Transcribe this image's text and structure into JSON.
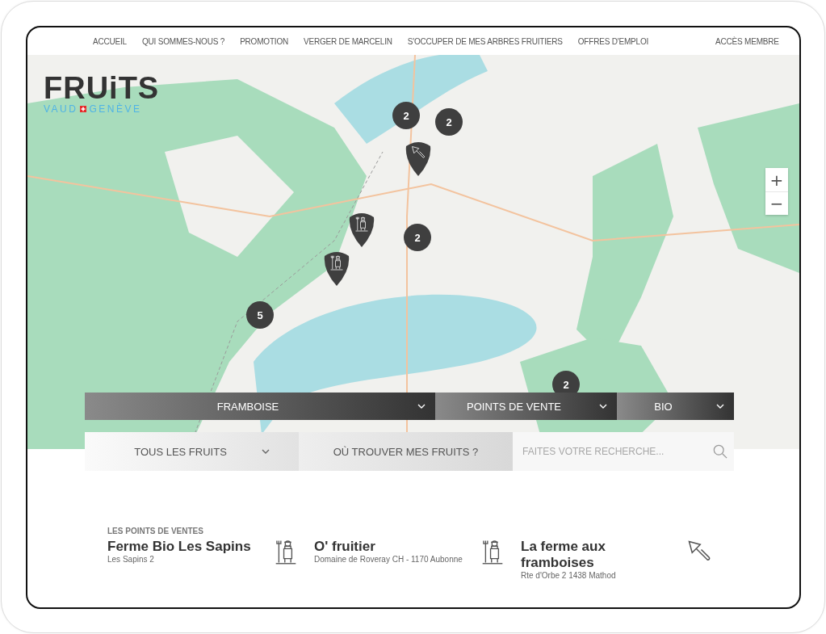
{
  "nav": {
    "items": [
      {
        "label": "ACCUEIL"
      },
      {
        "label": "QUI SOMMES-NOUS ?"
      },
      {
        "label": "PROMOTION"
      },
      {
        "label": "VERGER DE MARCELIN"
      },
      {
        "label": "S'OCCUPER DE MES ARBRES FRUITIERS"
      },
      {
        "label": "OFFRES D'EMPLOI"
      }
    ],
    "member_link": "ACCÈS MEMBRE"
  },
  "logo": {
    "title": "FRUiTS",
    "left": "VAUD",
    "right": "GENÈVE"
  },
  "map": {
    "markers": [
      {
        "kind": "cluster",
        "count": "2"
      },
      {
        "kind": "cluster",
        "count": "2"
      },
      {
        "kind": "trowel-pin"
      },
      {
        "kind": "farmer-pin"
      },
      {
        "kind": "cluster",
        "count": "2"
      },
      {
        "kind": "farmer-pin"
      },
      {
        "kind": "cluster",
        "count": "5"
      },
      {
        "kind": "cluster",
        "count": "2"
      }
    ],
    "zoom_in": "+",
    "zoom_out": "−"
  },
  "filters": [
    {
      "label": "FRAMBOISE"
    },
    {
      "label": "POINTS DE VENTE"
    },
    {
      "label": "BIO"
    }
  ],
  "search_bar": [
    {
      "kind": "dropdown",
      "label": "TOUS LES FRUITS"
    },
    {
      "kind": "button",
      "label": "OÙ TROUVER MES FRUITS ?"
    },
    {
      "kind": "search",
      "placeholder": "FAITES VOTRE RECHERCHE..."
    }
  ],
  "listing": {
    "heading": "LES POINTS DE VENTES",
    "items": [
      {
        "name": "Ferme Bio Les Sapins",
        "address": "Les Sapins 2",
        "kind": "farmer"
      },
      {
        "name": "O' fruitier",
        "address": "Domaine de Roveray CH - 1170 Aubonne",
        "kind": "farmer"
      },
      {
        "name": "La ferme aux framboises",
        "address": "Rte d'Orbe 2 1438 Mathod",
        "kind": "trowel"
      }
    ]
  }
}
